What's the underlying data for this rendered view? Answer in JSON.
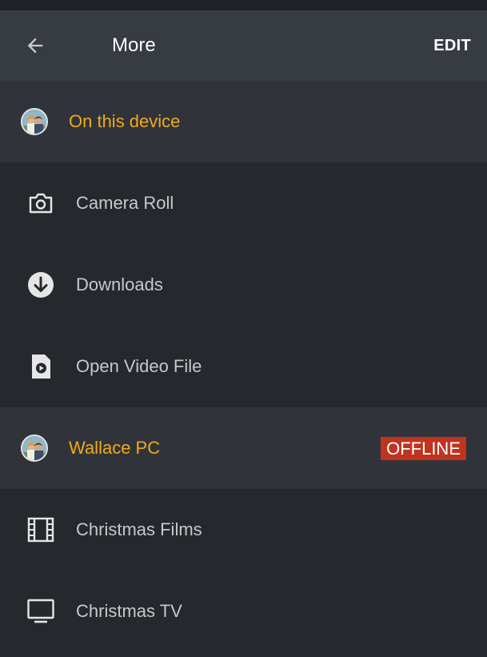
{
  "header": {
    "title": "More",
    "edit_label": "EDIT"
  },
  "sections": [
    {
      "title": "On this device",
      "items": [
        {
          "label": "Camera Roll",
          "icon": "camera-icon"
        },
        {
          "label": "Downloads",
          "icon": "download-icon"
        },
        {
          "label": "Open Video File",
          "icon": "video-file-icon"
        }
      ]
    },
    {
      "title": "Wallace PC",
      "status": "OFFLINE",
      "items": [
        {
          "label": "Christmas Films",
          "icon": "film-icon"
        },
        {
          "label": "Christmas TV",
          "icon": "tv-icon"
        }
      ]
    }
  ],
  "colors": {
    "accent": "#f0aa1b",
    "offline": "#c0331f",
    "appbar": "#373b42",
    "background": "#25282d"
  }
}
